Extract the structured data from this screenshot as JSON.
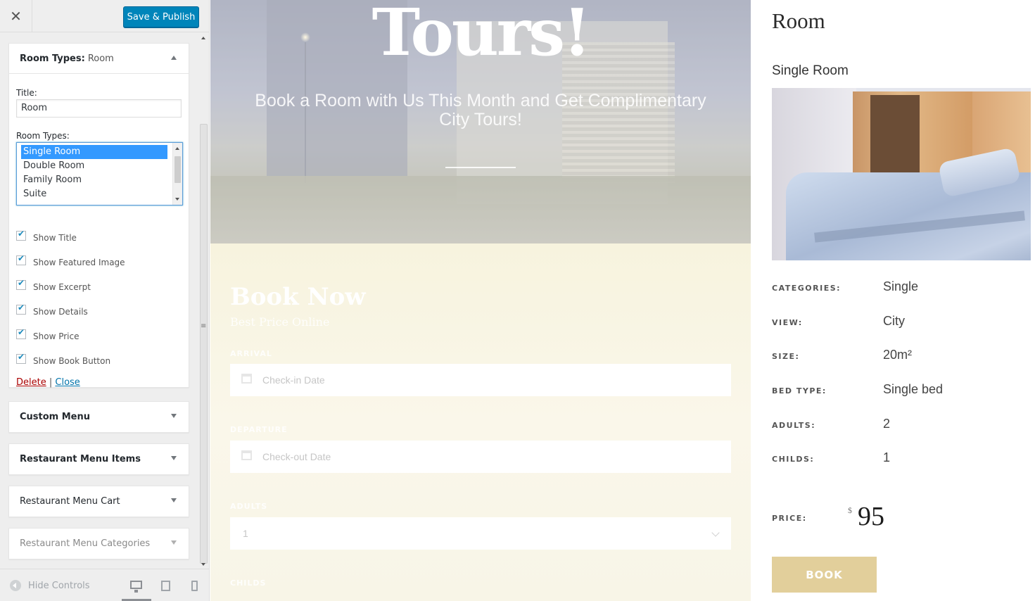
{
  "topbar": {
    "close_glyph": "✕",
    "publish_label": "Save & Publish"
  },
  "room_widget": {
    "header_label": "Room Types:",
    "header_value": "Room",
    "title_label": "Title:",
    "title_value": "Room",
    "roomtypes_label": "Room Types:",
    "roomtypes_options": [
      "Single Room",
      "Double Room",
      "Family Room",
      "Suite"
    ],
    "roomtypes_selected": "Single Room",
    "checkboxes": [
      {
        "label": "Show Title",
        "checked": true
      },
      {
        "label": "Show Featured Image",
        "checked": true
      },
      {
        "label": "Show Excerpt",
        "checked": true
      },
      {
        "label": "Show Details",
        "checked": true
      },
      {
        "label": "Show Price",
        "checked": true
      },
      {
        "label": "Show Book Button",
        "checked": true
      }
    ],
    "delete_label": "Delete",
    "separator": "|",
    "close_label": "Close"
  },
  "sections": [
    {
      "label": "Custom Menu"
    },
    {
      "label": "Restaurant Menu Items"
    },
    {
      "label": "Restaurant Menu Cart"
    },
    {
      "label": "Restaurant Menu Categories"
    }
  ],
  "footer": {
    "hide_controls_label": "Hide Controls",
    "devices": [
      "desktop-icon",
      "tablet-icon",
      "mobile-icon"
    ]
  },
  "preview": {
    "hero": {
      "title": "Tours!",
      "subtitle": "Book a Room with Us This Month and Get Complimentary City Tours!"
    },
    "booking": {
      "title": "Book Now",
      "subtitle": "Best Price Online",
      "arrival_label": "ARRIVAL",
      "checkin_placeholder": "Check-in Date",
      "departure_label": "DEPARTURE",
      "checkout_placeholder": "Check-out Date",
      "adults_label": "ADULTS",
      "adults_value": "1",
      "childs_label": "CHILDS"
    },
    "room": {
      "heading": "Room",
      "name": "Single Room",
      "specs": [
        {
          "key": "CATEGORIES:",
          "value": "Single"
        },
        {
          "key": "VIEW:",
          "value": "City"
        },
        {
          "key": "SIZE:",
          "value": "20m²"
        },
        {
          "key": "BED TYPE:",
          "value": "Single bed"
        },
        {
          "key": "ADULTS:",
          "value": "2"
        },
        {
          "key": "CHILDS:",
          "value": "1"
        }
      ],
      "price_label": "PRICE:",
      "currency": "$",
      "price": "95",
      "book_label": "BOOK"
    }
  },
  "colors": {
    "publish_blue": "#0085ba",
    "selection_blue": "#3399ff",
    "book_gold": "#e2cf9b",
    "delete_red": "#a00"
  }
}
